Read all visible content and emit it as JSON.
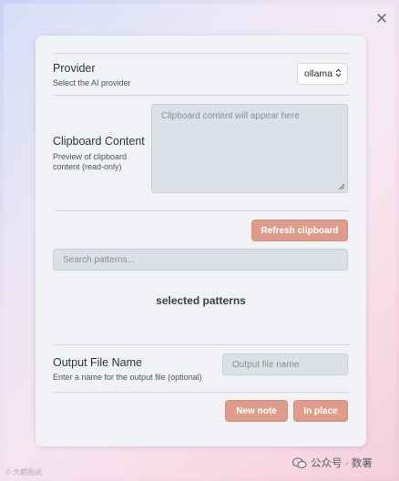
{
  "close_label": "✕",
  "provider": {
    "title": "Provider",
    "subtitle": "Select the AI provider",
    "selected": "ollama",
    "chevron": "⌃⌄"
  },
  "clipboard": {
    "title": "Clipboard Content",
    "subtitle_line1": "Preview of clipboard",
    "subtitle_line2": "content (read-only)",
    "placeholder": "Clipboard content will appear here"
  },
  "refresh_button": "Refresh clipboard",
  "search": {
    "placeholder": "Search patterns..."
  },
  "selected_patterns_label": "selected patterns",
  "output": {
    "title": "Output File Name",
    "subtitle": "Enter a name for the output file (optional)",
    "placeholder": "Output file name"
  },
  "buttons": {
    "new_note": "New note",
    "in_place": "In place"
  },
  "watermark": {
    "left": "© 大都图说",
    "right": "公众号 · 数署"
  },
  "colors": {
    "accent": "#de9c8c",
    "card": "#f0f2f6",
    "field": "#dde0e6"
  },
  "icons": {
    "close": "close-icon",
    "chevron": "chevron-updown-icon",
    "resize": "resize-handle-icon",
    "wechat": "wechat-icon"
  }
}
